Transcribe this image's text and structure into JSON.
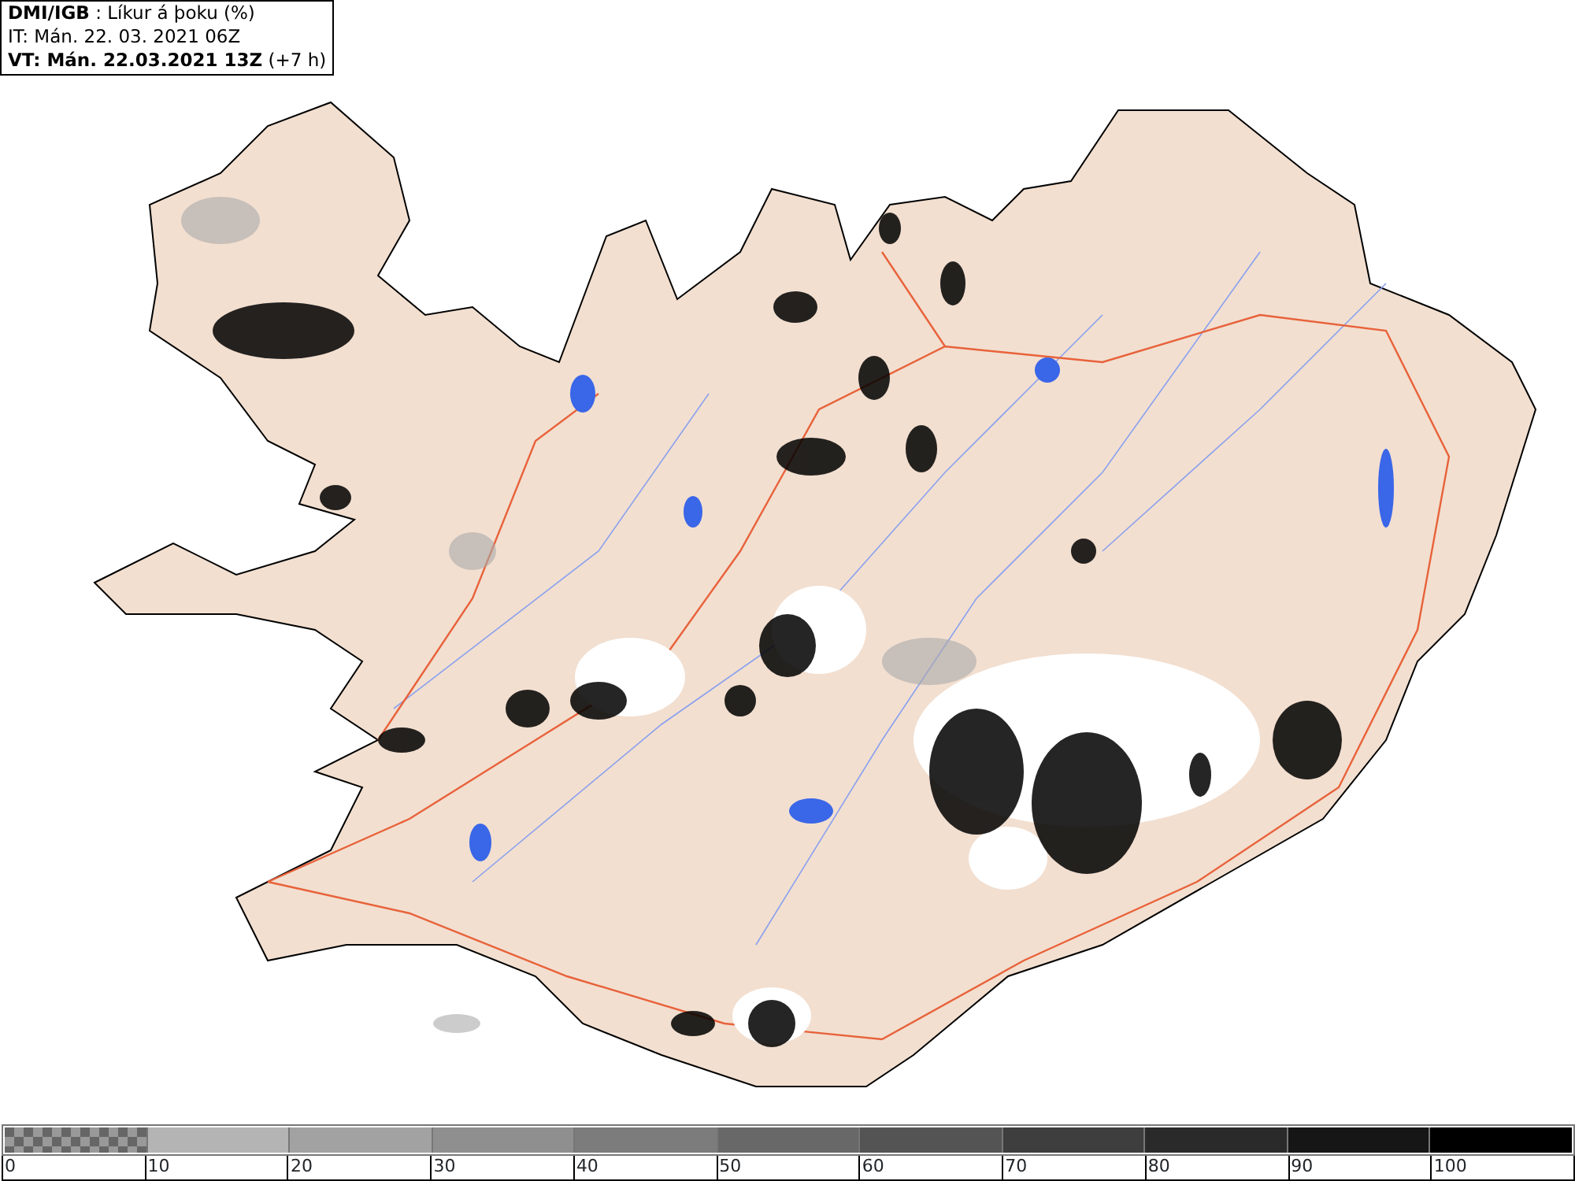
{
  "title_box": {
    "lines": [
      "**DMI/IGB** : Líkur á þoku (%)",
      "IT: Mán. 22. 03. 2021 06Z",
      "**VT: Mán. 22.03.2021 13Z** (+7 h)"
    ]
  },
  "legend": {
    "classes": [
      {
        "kind": "checkered",
        "color": "#999999",
        "label": "0"
      },
      {
        "kind": "solid",
        "color": "#b4b4b4",
        "label": "10"
      },
      {
        "kind": "solid",
        "color": "#a2a2a2",
        "label": "20"
      },
      {
        "kind": "solid",
        "color": "#8f8f8f",
        "label": "30"
      },
      {
        "kind": "solid",
        "color": "#7c7c7c",
        "label": "40"
      },
      {
        "kind": "solid",
        "color": "#686868",
        "label": "50"
      },
      {
        "kind": "solid",
        "color": "#545454",
        "label": "60"
      },
      {
        "kind": "solid",
        "color": "#3e3e3e",
        "label": "70"
      },
      {
        "kind": "solid",
        "color": "#2a2a2a",
        "label": "80"
      },
      {
        "kind": "solid",
        "color": "#161616",
        "label": "90"
      },
      {
        "kind": "solid",
        "color": "#000000",
        "label": "100"
      }
    ]
  }
}
